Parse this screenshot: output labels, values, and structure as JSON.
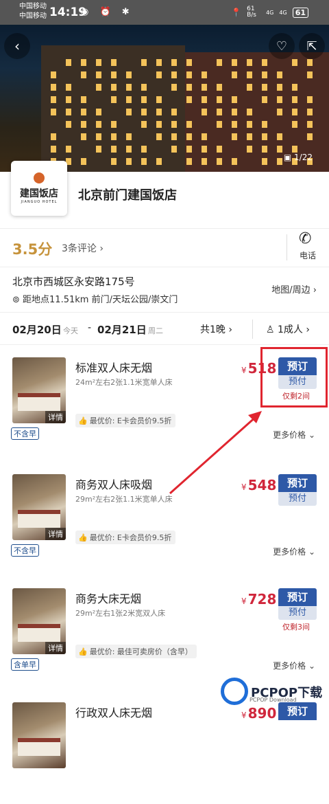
{
  "status_bar": {
    "carrier1": "中国移动",
    "carrier2": "中国移动",
    "time": "14:19",
    "icons_left": "◉ ⏰ ✱",
    "net_speed": "61 B/s",
    "signal1": "4G",
    "signal2": "4G",
    "battery": "61"
  },
  "hero": {
    "photo_counter": "1/22",
    "back_icon": "chevron-left-icon",
    "favorite_icon": "heart-icon",
    "share_icon": "share-icon"
  },
  "logo": {
    "cn": "建国饭店",
    "en": "JIANGUO HOTEL"
  },
  "hotel": {
    "name": "北京前门建国饭店",
    "score": "3.5分",
    "reviews": "3条评论",
    "phone_label": "电话",
    "address": "北京市西城区永安路175号",
    "distance": "距地点11.51km 前门/天坛公园/崇文门",
    "map_link": "地图/周边"
  },
  "dates": {
    "checkin": "02月20日",
    "checkin_sub": "今天",
    "separator": "-",
    "checkout": "02月21日",
    "checkout_sub": "周二",
    "nights": "共1晚",
    "guests": "1成人"
  },
  "rooms": [
    {
      "name": "标准双人床无烟",
      "desc": "24m²左右2张1.1米宽单人床",
      "promo": "最优价: E卡会员价9.5折",
      "currency": "¥",
      "price": "518",
      "book": "预订",
      "pay": "预付",
      "left": "仅剩2间",
      "meal": "不含早",
      "more": "更多价格",
      "detail": "详情"
    },
    {
      "name": "商务双人床吸烟",
      "desc": "29m²左右2张1.1米宽单人床",
      "promo": "最优价: E卡会员价9.5折",
      "currency": "¥",
      "price": "548",
      "book": "预订",
      "pay": "预付",
      "left": "",
      "meal": "不含早",
      "more": "更多价格",
      "detail": "详情"
    },
    {
      "name": "商务大床无烟",
      "desc": "29m²左右1张2米宽双人床",
      "promo": "最优价: 最佳可卖房价（含早）",
      "currency": "¥",
      "price": "728",
      "book": "预订",
      "pay": "预付",
      "left": "仅剩3间",
      "meal": "含单早",
      "more": "更多价格",
      "detail": "详情"
    },
    {
      "name": "行政双人床无烟",
      "currency": "¥",
      "price": "890",
      "book": "预订"
    }
  ],
  "watermark": {
    "text": "PCPOP下载",
    "sub": "PCPOP Download"
  },
  "annotation": {
    "color": "#e0252f"
  }
}
